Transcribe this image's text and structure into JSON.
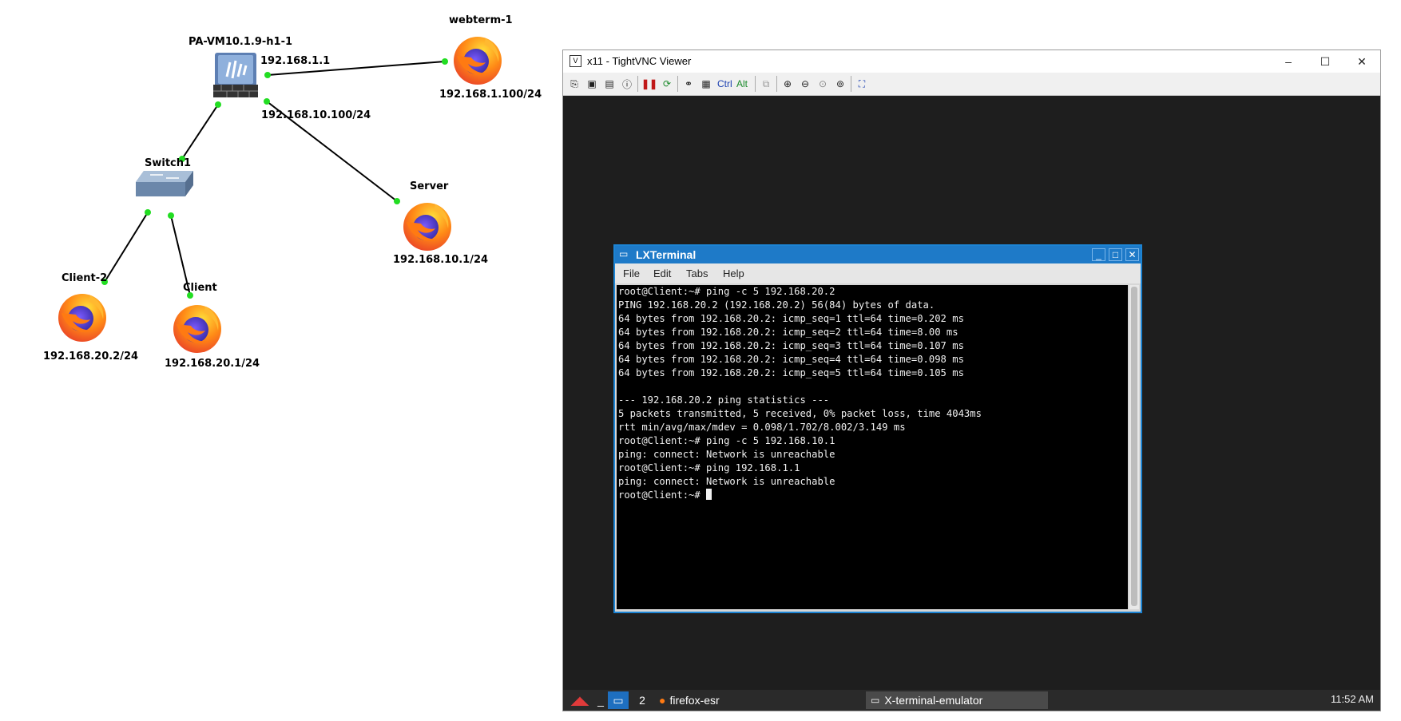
{
  "topology": {
    "nodes": {
      "firewall": {
        "name": "PA-VM10.1.9-h1-1",
        "ip_wan": "192.168.1.1",
        "ip_dmz": "192.168.10.100/24"
      },
      "webterm": {
        "name": "webterm-1",
        "ip": "192.168.1.100/24"
      },
      "switch": {
        "name": "Switch1"
      },
      "server": {
        "name": "Server",
        "ip": "192.168.10.1/24"
      },
      "client2": {
        "name": "Client-2",
        "ip": "192.168.20.2/24"
      },
      "client": {
        "name": "Client",
        "ip": "192.168.20.1/24"
      }
    },
    "link_color": "#000000",
    "port_color": "#22dd22"
  },
  "vnc": {
    "title": "x11 - TightVNC Viewer",
    "toolbar": {
      "ctrl_label": "Ctrl",
      "alt_label": "Alt"
    },
    "window_buttons": {
      "minimize": "–",
      "maximize": "☐",
      "close": "✕"
    }
  },
  "lxterminal": {
    "title": "LXTerminal",
    "menu": [
      "File",
      "Edit",
      "Tabs",
      "Help"
    ],
    "lines": [
      "root@Client:~# ping -c 5 192.168.20.2",
      "PING 192.168.20.2 (192.168.20.2) 56(84) bytes of data.",
      "64 bytes from 192.168.20.2: icmp_seq=1 ttl=64 time=0.202 ms",
      "64 bytes from 192.168.20.2: icmp_seq=2 ttl=64 time=8.00 ms",
      "64 bytes from 192.168.20.2: icmp_seq=3 ttl=64 time=0.107 ms",
      "64 bytes from 192.168.20.2: icmp_seq=4 ttl=64 time=0.098 ms",
      "64 bytes from 192.168.20.2: icmp_seq=5 ttl=64 time=0.105 ms",
      "",
      "--- 192.168.20.2 ping statistics ---",
      "5 packets transmitted, 5 received, 0% packet loss, time 4043ms",
      "rtt min/avg/max/mdev = 0.098/1.702/8.002/3.149 ms",
      "root@Client:~# ping -c 5 192.168.10.1",
      "ping: connect: Network is unreachable",
      "root@Client:~# ping 192.168.1.1",
      "ping: connect: Network is unreachable"
    ],
    "prompt": "root@Client:~# "
  },
  "taskbar": {
    "desktop_number": "2",
    "task_firefox": "firefox-esr",
    "task_terminal": "X-terminal-emulator",
    "clock": "11:52 AM"
  }
}
